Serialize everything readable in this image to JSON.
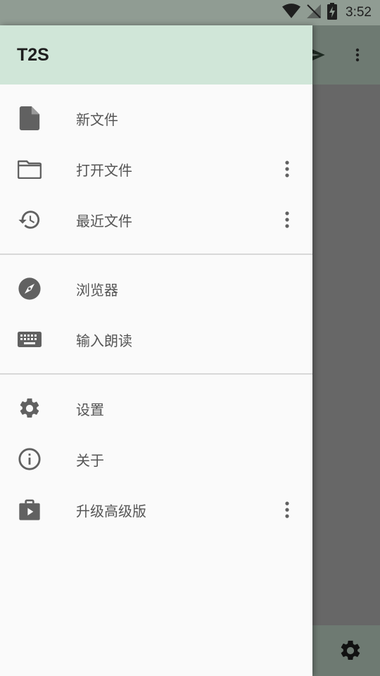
{
  "status_bar": {
    "time": "3:52",
    "icons": [
      "wifi-icon",
      "signal-off-icon",
      "battery-charging-icon"
    ]
  },
  "drawer": {
    "title": "T2S",
    "sections": [
      {
        "items": [
          {
            "label": "新文件",
            "icon": "new-file-icon"
          },
          {
            "label": "打开文件",
            "icon": "folder-icon",
            "more": true
          },
          {
            "label": "最近文件",
            "icon": "history-icon",
            "more": true
          }
        ]
      },
      {
        "items": [
          {
            "label": "浏览器",
            "icon": "compass-icon"
          },
          {
            "label": "输入朗读",
            "icon": "keyboard-icon"
          }
        ]
      },
      {
        "items": [
          {
            "label": "设置",
            "icon": "gear-icon"
          },
          {
            "label": "关于",
            "icon": "info-icon"
          },
          {
            "label": "升级高级版",
            "icon": "store-icon",
            "more": true
          }
        ]
      }
    ]
  },
  "background_app": {
    "toolbar_icons": [
      "send-icon",
      "more-vert-icon"
    ],
    "bottom_icon": "gear-icon"
  },
  "colors": {
    "drawer_header": "#d0e6d8",
    "icon": "#616161",
    "label": "#555555"
  }
}
